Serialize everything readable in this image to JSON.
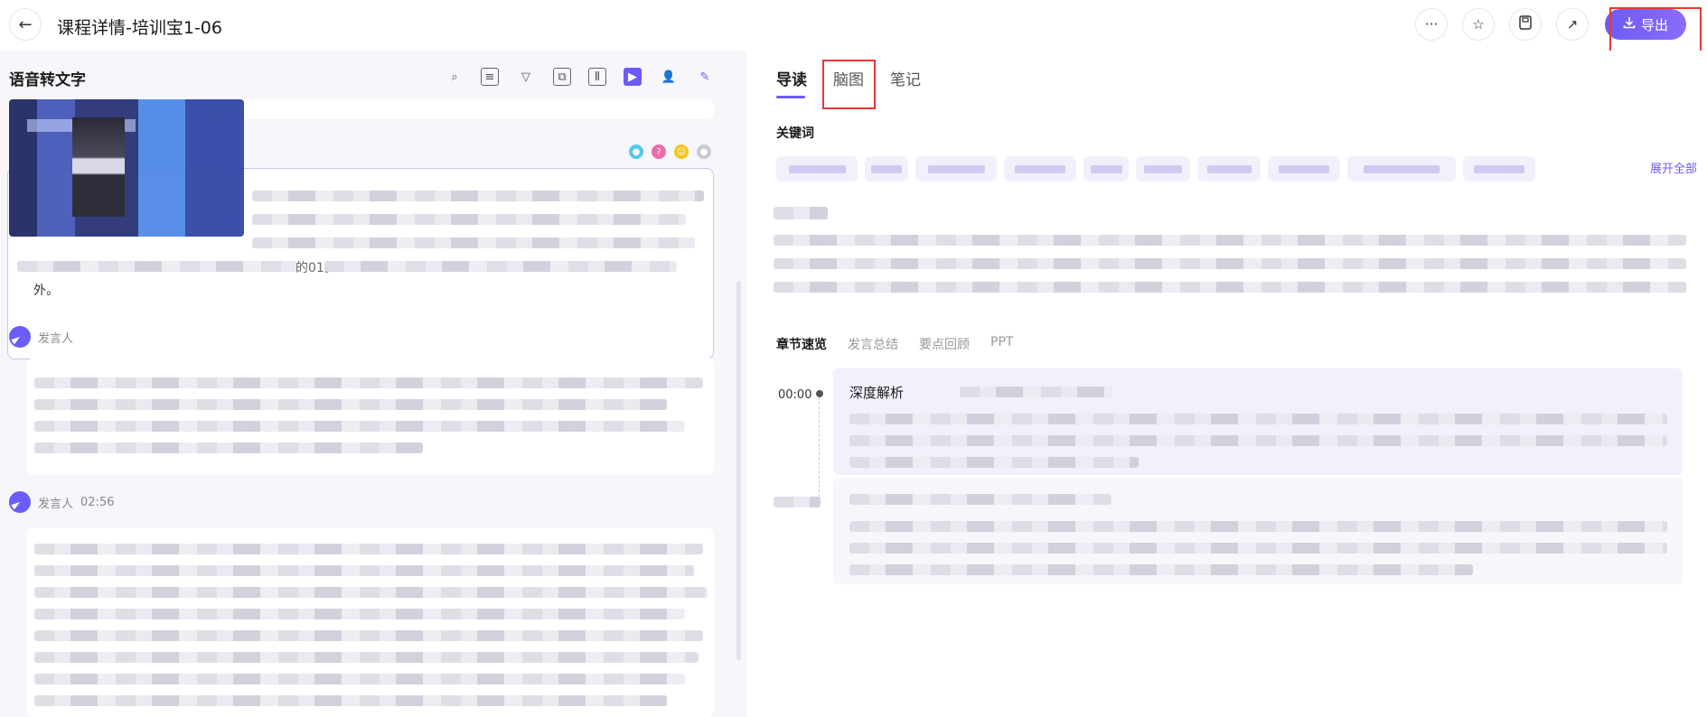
{
  "header": {
    "back_icon": "arrow-left-icon",
    "title": "课程详情-培训宝1-06",
    "actions": [
      "more-icon",
      "star-icon",
      "save-icon",
      "share-icon"
    ],
    "export_label": "导出",
    "export_icon": "download-icon",
    "accent": "#6b5cf6"
  },
  "left": {
    "title": "语音转文字",
    "toolbar_icons": [
      "search-icon",
      "doc-icon",
      "filter-icon",
      "copy-icon",
      "note-icon",
      "video-icon",
      "speaker-icon",
      "pen-icon"
    ],
    "active_tool": "video-icon",
    "first_block_tail": "外。",
    "first_block_fragment": "的01。",
    "speakers": [
      {
        "name": "发言人",
        "time": ""
      },
      {
        "name": "发言人",
        "time": "02:56"
      }
    ]
  },
  "right": {
    "tabs": [
      "导读",
      "脑图",
      "笔记"
    ],
    "active_tab": "导读",
    "keywords_label": "关键词",
    "expand_label": "展开全部",
    "subtabs": [
      "章节速览",
      "发言总结",
      "要点回顾",
      "PPT"
    ],
    "active_subtab": "章节速览",
    "chapter_time": "00:00",
    "chapter_title": "深度解析"
  }
}
